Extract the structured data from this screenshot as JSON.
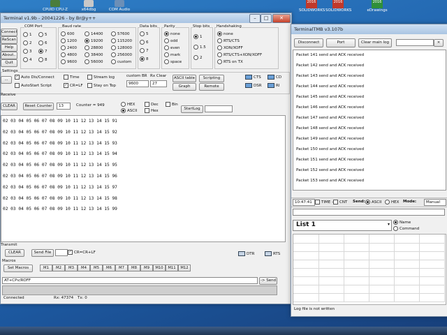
{
  "desktop": {
    "icons": [
      {
        "label": "CPUID CPU-Z",
        "color": "#4a7d3c"
      },
      {
        "label": "x64dbg",
        "color": "#c8c8c8"
      },
      {
        "label": "COM Audio",
        "color": "#6c8fb7"
      }
    ],
    "top_right_icons": [
      {
        "line1": "SOLIDWORKS",
        "line2": "2016",
        "color": "#c0392b"
      },
      {
        "line1": "SOLIDWORKS",
        "line2": "2016",
        "color": "#c0392b"
      },
      {
        "line1": "eDrawings",
        "line2": "2016",
        "color": "#2f8f3a"
      }
    ]
  },
  "terminal": {
    "title": "Terminal v1.9b - 20041226 - by Br@y++",
    "buttons": {
      "connect": "Connect",
      "rescan": "ReScan",
      "help": "Help",
      "about": "About..",
      "quit": "Quit"
    },
    "com_port": {
      "label": "COM Port",
      "options": [
        "1",
        "2",
        "3",
        "4",
        "5",
        "6",
        "7",
        "8"
      ],
      "selected": "7"
    },
    "baud_rate": {
      "label": "Baud rate",
      "col1": [
        "600",
        "1200",
        "2400",
        "4800",
        "9600"
      ],
      "col2": [
        "14400",
        "19200",
        "28800",
        "38400",
        "56000"
      ],
      "col3": [
        "57600",
        "115200",
        "128000",
        "256000",
        "custom"
      ],
      "selected": "19200"
    },
    "data_bits": {
      "label": "Data bits",
      "options": [
        "5",
        "6",
        "7",
        "8"
      ],
      "selected": "8"
    },
    "parity": {
      "label": "Parity",
      "options": [
        "none",
        "odd",
        "even",
        "mark",
        "space"
      ],
      "selected": "none"
    },
    "stop_bits": {
      "label": "Stop bits",
      "options": [
        "1",
        "1.5",
        "2"
      ],
      "selected": "1"
    },
    "handshaking": {
      "label": "Handshaking",
      "options": [
        "none",
        "RTS/CTS",
        "XON/XOFF",
        "RTS/CTS+XON/XOFF",
        "RTS on TX"
      ],
      "selected": "none"
    },
    "settings": {
      "label": "Settings",
      "auto_dis_connect": "Auto Dis/Connect",
      "autostart_script": "AutoStart Script",
      "time": "Time",
      "cr_lf": "CR=LF",
      "stream_log": "Stream log",
      "stay_on_top": "Stay on Top",
      "custom_br_label": "custom BR",
      "custom_br_value": "9600",
      "rx_clear_label": "Rx Clear",
      "rx_clear_value": "27",
      "ascii_table": "ASCII table",
      "graph": "Graph",
      "scripting": "Scripting",
      "remote": "Remote",
      "cts": "CTS",
      "cd": "CD",
      "dsr": "DSR",
      "ri": "RI"
    },
    "receive": {
      "label": "Receive",
      "clear": "CLEAR",
      "reset_counter": "Reset Counter",
      "counter_spin": "13",
      "counter_text": "Counter = 949",
      "hex": "HEX",
      "ascii": "ASCII",
      "dec": "Dec",
      "bin": "Bin",
      "hex2": "Hex",
      "startlog": "StartLog",
      "lines": [
        "02 03 04 05 06 07 08 09 10 11 12 13 14 15 91",
        "02 03 04 05 06 07 08 09 10 11 12 13 14 15 92",
        "02 03 04 05 06 07 08 09 10 11 12 13 14 15 93",
        "02 03 04 05 06 07 08 09 10 11 12 13 14 15 94",
        "02 03 04 05 06 07 08 09 10 11 12 13 14 15 95",
        "02 03 04 05 06 07 08 09 10 11 12 13 14 15 96",
        "02 03 04 05 06 07 08 09 10 11 12 13 14 15 97",
        "02 03 04 05 06 07 08 09 10 11 12 13 14 15 98",
        "02 03 04 05 06 07 08 09 10 11 12 13 14 15 99"
      ]
    },
    "transmit": {
      "label": "Transmit",
      "clear": "CLEAR",
      "send_file": "Send File",
      "cr_crlf": "CR=CR+LF",
      "dtr": "DTR",
      "rts": "RTS"
    },
    "macros": {
      "label": "Macros",
      "set_macros": "Set Macros",
      "buttons": [
        "M1",
        "M2",
        "M3",
        "M4",
        "M5",
        "M6",
        "M7",
        "M8",
        "M9",
        "M10",
        "M11",
        "M12"
      ]
    },
    "input": {
      "value": "AT+CPv/ROFF",
      "send": "-> Send"
    },
    "status": {
      "connection": "Connected",
      "rx": "Rx: 47374",
      "tx": "Tx: 0"
    }
  },
  "terminal_tmb": {
    "title": "TerminalTMB v3.107b",
    "disconnect": "Disconnect",
    "port": "Port",
    "clear_main_log": "Clear main log",
    "packets": [
      "Packet 141 send and ACK received",
      "Packet 142 send and ACK received",
      "Packet 143 send and ACK received",
      "Packet 144 send and ACK received",
      "Packet 145 send and ACK received",
      "Packet 146 send and ACK received",
      "Packet 147 send and ACK received",
      "Packet 148 send and ACK received",
      "Packet 149 send and ACK received",
      "Packet 150 send and ACK received",
      "Packet 151 send and ACK received",
      "Packet 152 send and ACK received",
      "Packet 153 send and ACK received"
    ],
    "time": "10:47:41",
    "time_plus": "TIME +",
    "cnt": "CNT",
    "send_label": "Send:",
    "ascii": "ASCII",
    "hex": "HEX",
    "mode_label": "Mode:",
    "mode_value": "Manual",
    "list_name": "List 1",
    "name_opt": "Name",
    "command_opt": "Command",
    "log_status": "Log file is not written"
  }
}
